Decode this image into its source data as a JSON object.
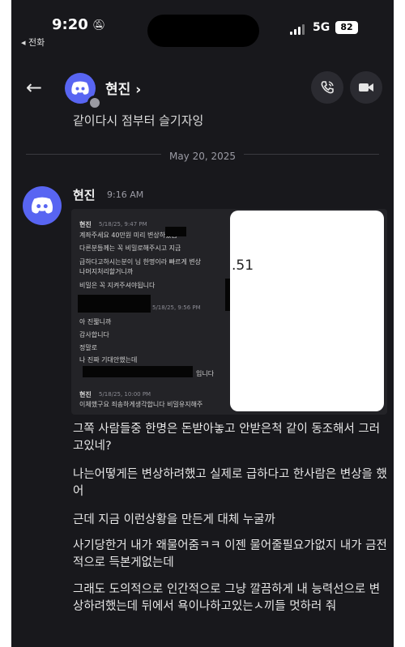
{
  "status_bar": {
    "time": "9:20",
    "back_label": "◂ 전화",
    "network": "5G",
    "battery": "82"
  },
  "header": {
    "contact_name": "현진 ›"
  },
  "previous_message": "같이다시 점부터 슬기자잉",
  "date_divider": "May 20, 2025",
  "message": {
    "author": "현진",
    "time": "9:16 AM"
  },
  "screenshot": {
    "blocks": [
      {
        "name": "현진",
        "time": "5/18/25, 9:47 PM",
        "lines": [
          "계좌주세요 40만원 미리 변상하겠습",
          "다른분들께는 꼭 비밀로해주시고 지금",
          "급하다고하시는분이 님 한명이라 빠르게 변상",
          "나머지처리할거니까",
          "비밀은 꼭 지켜주셔야됩니다"
        ]
      },
      {
        "name": "",
        "time": "5/18/25, 9:56 PM",
        "lines": [
          "아 진짧니까",
          "감사합니다",
          "정말로",
          "나 진짜 기대안했는데",
          "입니다"
        ]
      },
      {
        "name": "현진",
        "time": "5/18/25, 10:00 PM",
        "lines": [
          "이체했구요 죄송하게생각합니다 비밀유지해주"
        ]
      }
    ],
    "partial_number": ".51"
  },
  "body_lines": [
    "그쪽 사람들중 한명은 돈받아놓고 안받은척 같이 동조해서 그러고있네?",
    "나는어떻게든 변상하려했고 실제로 급하다고 한사람은 변상을 했어",
    "근데 지금 이런상황을 만든게 대체 누굴까",
    "사기당한거 내가 왜물어줌ㅋㅋ 이젠 물어줄필요가없지 내가 금전적으로 득본게없는데",
    "그래도 도의적으로 인간적으로 그냥 깔끔하게 내 능력선으로 변상하려했는데 뒤에서 욕이나하고있는ㅅ끼들 멋하러 줘"
  ],
  "icons": [
    "back-arrow-icon",
    "discord-icon",
    "phone-call-icon",
    "video-camera-icon",
    "bell-slash-icon",
    "signal-icon"
  ],
  "colors": {
    "background": "#18181c",
    "discord": "#5865f2",
    "button": "#2b2b31"
  }
}
